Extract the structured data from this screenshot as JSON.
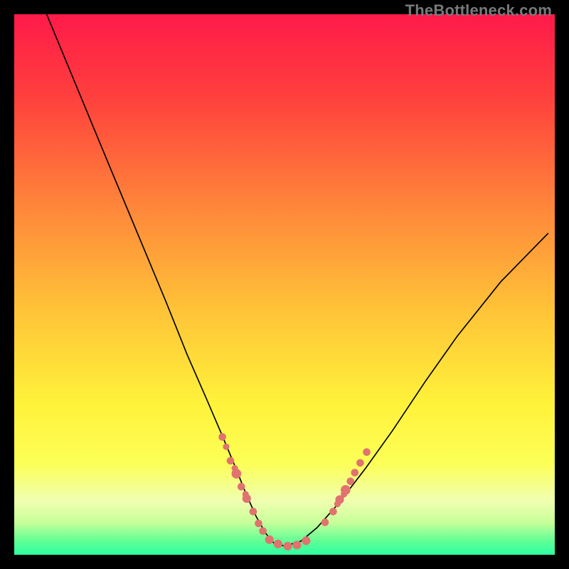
{
  "watermark": "TheBottleneck.com",
  "colors": {
    "gradient_stops": [
      {
        "offset": 0.0,
        "color": "#ff1a4a"
      },
      {
        "offset": 0.15,
        "color": "#ff3f3d"
      },
      {
        "offset": 0.35,
        "color": "#ff843a"
      },
      {
        "offset": 0.55,
        "color": "#ffc438"
      },
      {
        "offset": 0.72,
        "color": "#fff23a"
      },
      {
        "offset": 0.83,
        "color": "#fcff56"
      },
      {
        "offset": 0.9,
        "color": "#f0ffb0"
      },
      {
        "offset": 0.94,
        "color": "#c8ff9a"
      },
      {
        "offset": 0.975,
        "color": "#5fff95"
      },
      {
        "offset": 1.0,
        "color": "#2dffa2"
      }
    ],
    "dot": "#e0736f",
    "curve": "#000000",
    "frame": "#000000"
  },
  "chart_data": {
    "type": "line",
    "title": "",
    "xlabel": "",
    "ylabel": "",
    "xlim": [
      0,
      1000
    ],
    "ylim": [
      0,
      1000
    ],
    "grid": false,
    "note": "Axes are unlabeled; values are pixel-space coordinates (0–1000) within the colored plot area. Curve is an asymmetric V/U shape: left branch descends steeply from top-left, bottoms out near x≈475, right branch rises more gently toward upper-right. Dots cluster near the bottom of the V on both branches.",
    "series": [
      {
        "name": "bottleneck-curve",
        "style": "line",
        "x": [
          60,
          120,
          180,
          230,
          280,
          320,
          355,
          385,
          410,
          430,
          448,
          465,
          480,
          500,
          530,
          560,
          600,
          650,
          700,
          760,
          820,
          900,
          988
        ],
        "y": [
          1000,
          855,
          710,
          590,
          470,
          370,
          290,
          220,
          160,
          110,
          70,
          40,
          22,
          16,
          25,
          50,
          95,
          160,
          230,
          320,
          405,
          505,
          595
        ]
      },
      {
        "name": "left-branch-dots",
        "style": "scatter",
        "points": [
          {
            "x": 385,
            "y": 218,
            "r": 7
          },
          {
            "x": 392,
            "y": 200,
            "r": 6
          },
          {
            "x": 400,
            "y": 174,
            "r": 7
          },
          {
            "x": 411,
            "y": 150,
            "r": 9
          },
          {
            "x": 408,
            "y": 160,
            "r": 6
          },
          {
            "x": 420,
            "y": 126,
            "r": 7
          },
          {
            "x": 430,
            "y": 104,
            "r": 8
          },
          {
            "x": 428,
            "y": 112,
            "r": 6
          },
          {
            "x": 442,
            "y": 80,
            "r": 7
          },
          {
            "x": 452,
            "y": 58,
            "r": 7
          },
          {
            "x": 460,
            "y": 44,
            "r": 7
          }
        ]
      },
      {
        "name": "bottom-dots",
        "style": "scatter",
        "points": [
          {
            "x": 472,
            "y": 28,
            "r": 8
          },
          {
            "x": 488,
            "y": 20,
            "r": 8
          },
          {
            "x": 506,
            "y": 16,
            "r": 8
          },
          {
            "x": 523,
            "y": 18,
            "r": 8
          },
          {
            "x": 540,
            "y": 26,
            "r": 8
          }
        ]
      },
      {
        "name": "right-branch-dots",
        "style": "scatter",
        "points": [
          {
            "x": 575,
            "y": 60,
            "r": 7
          },
          {
            "x": 590,
            "y": 80,
            "r": 7
          },
          {
            "x": 602,
            "y": 102,
            "r": 8
          },
          {
            "x": 598,
            "y": 94,
            "r": 6
          },
          {
            "x": 613,
            "y": 120,
            "r": 9
          },
          {
            "x": 610,
            "y": 112,
            "r": 6
          },
          {
            "x": 622,
            "y": 136,
            "r": 7
          },
          {
            "x": 630,
            "y": 152,
            "r": 7
          },
          {
            "x": 640,
            "y": 170,
            "r": 7
          },
          {
            "x": 652,
            "y": 190,
            "r": 7
          }
        ]
      }
    ]
  }
}
